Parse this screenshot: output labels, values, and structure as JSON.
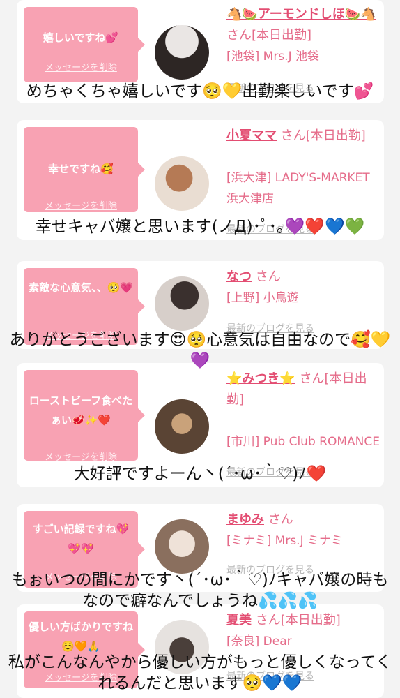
{
  "cards": [
    {
      "message": "嬉しいですね💕",
      "delete_label": "メッセージを削除",
      "name": "🐴🍉アーモンドしほ🍉🐴",
      "san": "さん[本日出勤]",
      "shop": "[池袋] Mrs.J 池袋",
      "blog_label": "最新のブログを見る",
      "caption": "めちゃくちゃ嬉しいです🥺💛出勤楽しいです💕",
      "avatar_colors": [
        "#d9d0cc",
        "#2d2624"
      ]
    },
    {
      "message": "幸せですね🥰",
      "delete_label": "メッセージを削除",
      "name": "小夏ママ",
      "san": "さん[本日出勤]",
      "shop": "[浜大津] LADY'S-MARKET 浜大津店",
      "blog_label": "最新のブログを見る",
      "caption": "幸せキャバ嬢と思います(ノД)･ﾟ･｡💜❤️💙💚",
      "avatar_colors": [
        "#e9ddd2",
        "#7a5038"
      ]
    },
    {
      "message": "素敵な心意気、、🥺💗",
      "delete_label": "メッセージを削除",
      "name": "なつ",
      "san": "さん",
      "shop": "[上野] 小鳥遊",
      "blog_label": "最新のブログを見る",
      "caption": "ありがとうございます😍🥺心意気は自由なので🥰💛💜",
      "avatar_colors": [
        "#cfc5c0",
        "#3a302e"
      ]
    },
    {
      "message": "ローストビーフ食べたぁい🥩✨❤️",
      "delete_label": "メッセージを削除",
      "name": "⭐️みつき⭐️",
      "san": "さん[本日出勤]",
      "shop": "[市川] Pub Club ROMANCE",
      "blog_label": "最新のブログを見る",
      "caption": "大好評ですよーん丶(´･ω･｀♡)ﾉ❤️",
      "avatar_colors": [
        "#5a4434",
        "#c9a27a"
      ]
    },
    {
      "message": "すごい記録ですね💖💖💖",
      "delete_label": "メッセージを削除",
      "name": "まゆみ",
      "san": "さん",
      "shop": "[ミナミ] Mrs.J ミナミ",
      "blog_label": "最新のブログを見る",
      "caption": "もぉいつの間にかです丶(´･ω･｀♡)ﾉキャバ嬢の時もなので癖なんでしょうね💦💦💦",
      "avatar_colors": [
        "#8a6f5e",
        "#efe2d8"
      ]
    },
    {
      "message": "優しい方ばかりですね☺️🧡🙏",
      "delete_label": "メッセージを削除",
      "name": "夏美",
      "san": "さん[本日出勤]",
      "shop": "[奈良] Dear",
      "blog_label": "最新のブログを見る",
      "caption": "私がこんなんやから優しい方がもっと優しくなってくれるんだと思います🥺💙💙",
      "avatar_colors": [
        "#e6e2df",
        "#4a3f3a"
      ]
    }
  ]
}
